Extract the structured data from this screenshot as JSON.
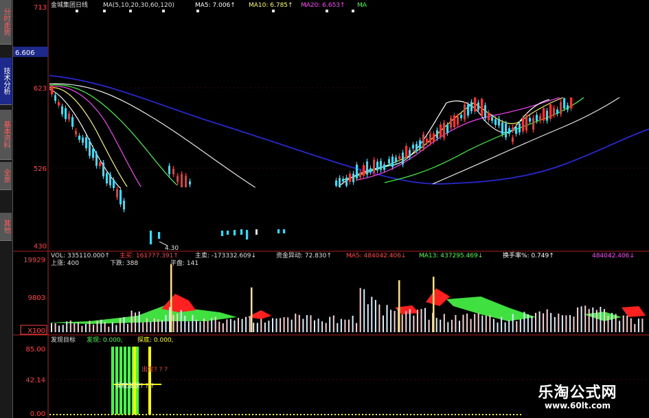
{
  "sidebar": {
    "tabs": [
      {
        "label": "分时走势",
        "active": false
      },
      {
        "label": "技术分析",
        "active": true
      },
      {
        "label": "基本资料",
        "active": false
      },
      {
        "label": "全景",
        "active": false
      },
      {
        "label": "其他",
        "active": false
      }
    ]
  },
  "price_panel": {
    "title": "金城集团日线",
    "ma_params": "MA(5,10,20,30,60,120)",
    "ma5": "MA5: 7.006↑",
    "ma10": "MA10: 6.785↑",
    "ma20": "MA20: 6.653↑",
    "ma30": "MA",
    "current_price_tag": "6.606",
    "y_ticks": [
      "713",
      "623",
      "526",
      "430"
    ],
    "low_marker": "4.30"
  },
  "volume_panel": {
    "vol": "VOL: 335110.000↑",
    "zhumai": "主买: 161777.391↑",
    "zhumai2": "主卖: -173332.609↓",
    "zijin": "资金异动: 72.830↑",
    "ma5": "MA5: 484042.406↓",
    "ma13": "MA13: 437295.469↓",
    "huanshou": "换手率%: 0.749↑",
    "tail": "484042.406↓",
    "up_label": "上涨: 400",
    "down_label": "下跌: 388",
    "flat_label": "平盘: 141",
    "y_ticks": [
      "19929",
      "9803",
      "X100"
    ]
  },
  "indicator_panel": {
    "title": "发现目标",
    "faxian": "发现: 0.000,",
    "tandi": "探底: 0.000,",
    "y_ticks": [
      "85.00",
      "42.14",
      "0.00"
    ],
    "note1": "出发? ? ?",
    "note2": "探底发现? ? ?"
  },
  "watermark": {
    "line1": "乐淘公式网",
    "line2": "www.60lt.com"
  },
  "colors": {
    "up": "#ff3030",
    "down": "#30e0ff",
    "axis": "#b02020",
    "ma5": "#ffffff",
    "ma10": "#ffff60",
    "ma20": "#ff40ff",
    "ma30": "#40ff40",
    "ma60": "#ffffff",
    "ma120": "#2828d0",
    "yellow": "#ffff00",
    "green": "#40ff40"
  },
  "chart_data": [
    {
      "type": "line",
      "name_text": "金城集团日线",
      "ylim": [
        4.3,
        7.13
      ],
      "series": [
        {
          "name": "MA60",
          "values": [
            6.45,
            6.3,
            6.1,
            5.95,
            5.8,
            5.55,
            5.45,
            5.3,
            5.2,
            5.25,
            5.55,
            5.75,
            5.95
          ]
        },
        {
          "name": "MA120",
          "values": [
            6.55,
            6.5,
            6.35,
            6.2,
            6.05,
            5.9,
            5.7,
            5.55,
            5.42,
            5.38,
            5.42,
            5.5,
            5.65
          ]
        }
      ],
      "x": [
        0,
        1,
        2,
        3,
        4,
        5,
        6,
        7,
        8,
        9,
        10,
        11,
        12
      ]
    },
    {
      "type": "bar",
      "ylim": [
        0,
        19929
      ],
      "series": [
        {
          "name": "VOL",
          "values": [
            2500,
            3000,
            2800,
            3200,
            3500,
            2800,
            4200,
            5500,
            3900,
            3600,
            7000,
            6200,
            4800,
            3800,
            4300,
            3600,
            4000,
            4500,
            3700,
            3900,
            4200,
            5200,
            4800,
            3800,
            4300,
            3700,
            4600,
            12000,
            9000,
            7600,
            6900,
            6400,
            6500,
            5400,
            5100,
            4800,
            5200,
            5300,
            4700,
            4300,
            5100,
            5700,
            5400,
            6400,
            5200,
            4800,
            7200,
            6900,
            6500,
            5100,
            4600,
            3800
          ]
        }
      ]
    },
    {
      "type": "bar",
      "ylim": [
        0,
        85.0
      ],
      "series": [
        {
          "name": "发现",
          "values": [
            0,
            0,
            85,
            85,
            85,
            85,
            85,
            85,
            85,
            0,
            0,
            0
          ]
        },
        {
          "name": "探底",
          "values": [
            0,
            0,
            0,
            0,
            0,
            0,
            0,
            85,
            0,
            85,
            0,
            0
          ]
        }
      ]
    }
  ]
}
